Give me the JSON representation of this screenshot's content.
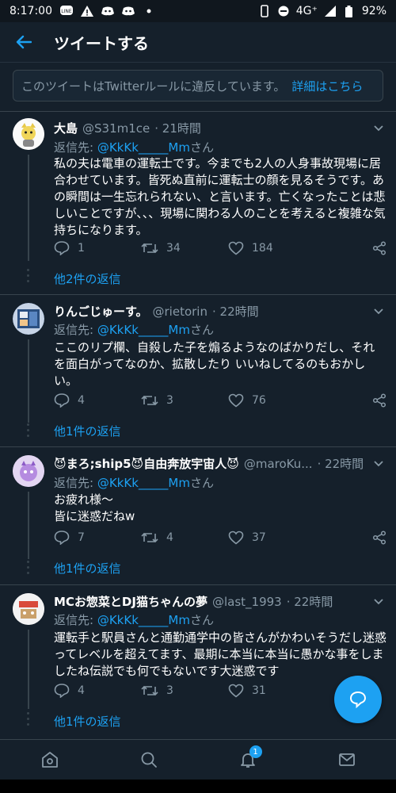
{
  "status_bar": {
    "time": "8:17:00",
    "network": "4G⁺",
    "battery": "92%"
  },
  "header": {
    "title": "ツイートする"
  },
  "notice": {
    "text": "このツイートはTwitterルールに違反しています。",
    "link": "詳細はこちら"
  },
  "reply_prefix": "返信先:",
  "tweets": [
    {
      "name": "大島",
      "handle": "@S31m1ce",
      "time": "· 21時間",
      "mention": "@KkKk_____Mm",
      "san": "さん",
      "body": "私の夫は電車の運転士です。今までも2人の人身事故現場に居合わせています。皆死ぬ直前に運転士の顔を見るそうです。あの瞬間は一生忘れられない、と言います。亡くなったことは悲しいことですが、、、現場に関わる人のことを考えると複雑な気持ちになります。",
      "replies": "1",
      "retweets": "34",
      "likes": "184",
      "more": "他2件の返信"
    },
    {
      "name": "りんごじゅーす。",
      "handle": "@rietorin",
      "time": "· 22時間",
      "mention": "@KkKk_____Mm",
      "san": "さん",
      "body": "ここのリプ欄、自殺した子を煽るようなのばかりだし、それを面白がってなのか、拡散したり いいねしてるのもおかしい。",
      "replies": "4",
      "retweets": "3",
      "likes": "76",
      "more": "他1件の返信"
    },
    {
      "name": "😈まろ;ship5😈自由奔放宇宙人😈",
      "handle": "@maroKu...",
      "time": "· 22時間",
      "mention": "@KkKk_____Mm",
      "san": "さん",
      "body": "お疲れ様～\n皆に迷惑だねw",
      "replies": "7",
      "retweets": "4",
      "likes": "37",
      "more": "他1件の返信"
    },
    {
      "name": "MCお惣菜とDJ猫ちゃんの夢",
      "handle": "@last_1993",
      "time": "· 22時間",
      "mention": "@KkKk_____Mm",
      "san": "さん",
      "body": "運転手と駅員さんと通勤通学中の皆さんがかわいそうだし迷惑ってレベルを超えてます、最期に本当に本当に愚かな事をしましたね伝説でも何でもないです大迷惑です",
      "replies": "4",
      "retweets": "3",
      "likes": "31",
      "more": "他1件の返信"
    }
  ],
  "nav": {
    "notification_badge": "1"
  },
  "colors": {
    "background": "#15202b",
    "accent": "#1da1f2",
    "muted": "#8899a6"
  }
}
